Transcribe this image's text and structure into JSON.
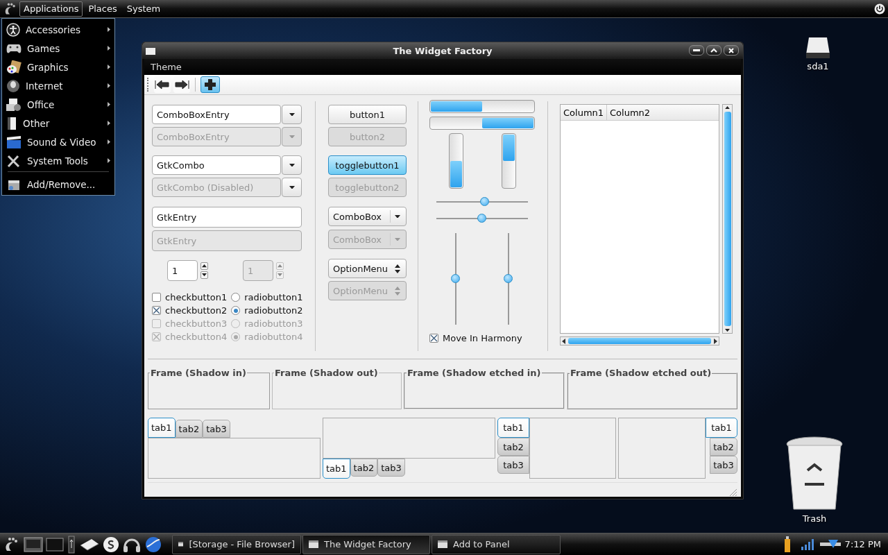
{
  "top_panel": {
    "menus": [
      {
        "label": "Applications",
        "selected": true
      },
      {
        "label": "Places",
        "selected": false
      },
      {
        "label": "System",
        "selected": false
      }
    ]
  },
  "app_menu": {
    "items": [
      {
        "label": "Accessories",
        "kind": "submenu"
      },
      {
        "label": "Games",
        "kind": "submenu"
      },
      {
        "label": "Graphics",
        "kind": "submenu"
      },
      {
        "label": "Internet",
        "kind": "submenu"
      },
      {
        "label": "Office",
        "kind": "submenu"
      },
      {
        "label": "Other",
        "kind": "submenu"
      },
      {
        "label": "Sound & Video",
        "kind": "submenu"
      },
      {
        "label": "System Tools",
        "kind": "submenu"
      },
      {
        "label": "Add/Remove...",
        "kind": "action"
      }
    ]
  },
  "desktop_icons": [
    {
      "label": "sda1",
      "kind": "drive"
    },
    {
      "label": "Trash",
      "kind": "trash"
    }
  ],
  "window": {
    "title": "The Widget Factory",
    "menu": [
      "Theme"
    ],
    "toolbar": [
      {
        "kind": "back",
        "selected": false
      },
      {
        "kind": "forward",
        "selected": false
      },
      {
        "kind": "separator"
      },
      {
        "kind": "add",
        "selected": true
      }
    ],
    "combo_entries": [
      {
        "value": "ComboBoxEntry",
        "disabled": false
      },
      {
        "value": "ComboBoxEntry",
        "disabled": true
      }
    ],
    "gtk_combos": [
      {
        "value": "GtkCombo",
        "disabled": false
      },
      {
        "value": "GtkCombo (Disabled)",
        "disabled": true
      }
    ],
    "entries": [
      {
        "value": "GtkEntry",
        "disabled": false
      },
      {
        "value": "GtkEntry",
        "disabled": true
      }
    ],
    "spin_buttons": [
      {
        "value": "1",
        "disabled": false
      },
      {
        "value": "1",
        "disabled": true
      }
    ],
    "check_buttons": [
      {
        "label": "checkbutton1",
        "checked": false,
        "disabled": false
      },
      {
        "label": "checkbutton2",
        "checked": true,
        "disabled": false
      },
      {
        "label": "checkbutton3",
        "checked": false,
        "disabled": true
      },
      {
        "label": "checkbutton4",
        "checked": true,
        "disabled": true
      }
    ],
    "radio_buttons": [
      {
        "label": "radiobutton1",
        "selected": false,
        "disabled": false
      },
      {
        "label": "radiobutton2",
        "selected": true,
        "disabled": false
      },
      {
        "label": "radiobutton3",
        "selected": false,
        "disabled": true
      },
      {
        "label": "radiobutton4",
        "selected": true,
        "disabled": true
      }
    ],
    "buttons": [
      {
        "label": "button1",
        "disabled": false
      },
      {
        "label": "button2",
        "disabled": true
      }
    ],
    "toggle_buttons": [
      {
        "label": "togglebutton1",
        "on": true,
        "disabled": false
      },
      {
        "label": "togglebutton2",
        "on": false,
        "disabled": true
      }
    ],
    "combo_boxes": [
      {
        "value": "ComboBox",
        "disabled": false
      },
      {
        "value": "ComboBox",
        "disabled": true
      }
    ],
    "option_menus": [
      {
        "value": "OptionMenu",
        "disabled": false
      },
      {
        "value": "OptionMenu",
        "disabled": true
      }
    ],
    "progress_bars": [
      {
        "level": 0.5,
        "inverted": false
      },
      {
        "level": 0.5,
        "inverted": true
      }
    ],
    "vertical_progress_bars": [
      {
        "level": 0.5,
        "inverted": false
      },
      {
        "level": 0.5,
        "inverted": true
      }
    ],
    "hscales": [
      {
        "level": 0.53
      },
      {
        "level": 0.5
      }
    ],
    "vscales": [
      {
        "level": 0.5
      },
      {
        "level": 0.5
      }
    ],
    "harmony": {
      "label": "Move In Harmony",
      "checked": true
    },
    "tree": {
      "columns": [
        "Column1",
        "Column2"
      ]
    },
    "frames": [
      {
        "label": "Frame (Shadow in)",
        "kind": "in"
      },
      {
        "label": "Frame (Shadow out)",
        "kind": "out"
      },
      {
        "label": "Frame (Shadow etched in)",
        "kind": "etched_in"
      },
      {
        "label": "Frame (Shadow etched out)",
        "kind": "etched_out"
      }
    ],
    "notebooks": [
      {
        "kind": "top",
        "tabs": [
          {
            "label": "tab1",
            "selected": true
          },
          {
            "label": "tab2",
            "selected": false
          },
          {
            "label": "tab3",
            "selected": false
          }
        ]
      },
      {
        "kind": "bottom",
        "tabs": [
          {
            "label": "tab1",
            "selected": true
          },
          {
            "label": "tab2",
            "selected": false
          },
          {
            "label": "tab3",
            "selected": false
          }
        ]
      },
      {
        "kind": "left",
        "tabs": [
          {
            "label": "tab1",
            "selected": true
          },
          {
            "label": "tab2",
            "selected": false
          },
          {
            "label": "tab3",
            "selected": false
          }
        ]
      },
      {
        "kind": "right",
        "tabs": [
          {
            "label": "tab1",
            "selected": true
          },
          {
            "label": "tab2",
            "selected": false
          },
          {
            "label": "tab3",
            "selected": false
          }
        ]
      }
    ]
  },
  "bottom_panel": {
    "tasks": [
      {
        "label": "[Storage - File Browser]",
        "selected": false
      },
      {
        "label": "The Widget Factory",
        "selected": true
      },
      {
        "label": "Add to Panel",
        "selected": false
      }
    ],
    "clock": "7:12 PM"
  }
}
